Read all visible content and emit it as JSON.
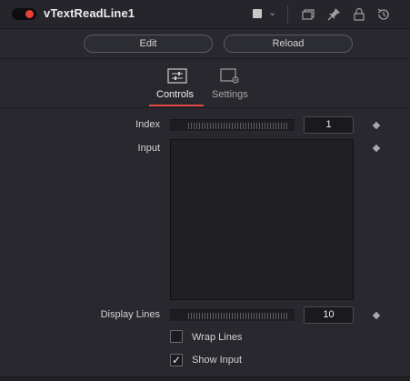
{
  "header": {
    "node_name": "vTextReadLine1"
  },
  "buttons": {
    "edit_label": "Edit",
    "reload_label": "Reload"
  },
  "tabs": [
    {
      "label": "Controls",
      "active": true
    },
    {
      "label": "Settings",
      "active": false
    }
  ],
  "controls": {
    "index": {
      "label": "Index",
      "value": "1"
    },
    "input": {
      "label": "Input",
      "value": ""
    },
    "display_lines": {
      "label": "Display Lines",
      "value": "10"
    },
    "wrap_lines": {
      "label": "Wrap Lines",
      "checked": false
    },
    "show_input": {
      "label": "Show Input",
      "checked": true,
      "mark": "✓"
    }
  },
  "colors": {
    "accent": "#e24a43",
    "background": "#28282e"
  }
}
